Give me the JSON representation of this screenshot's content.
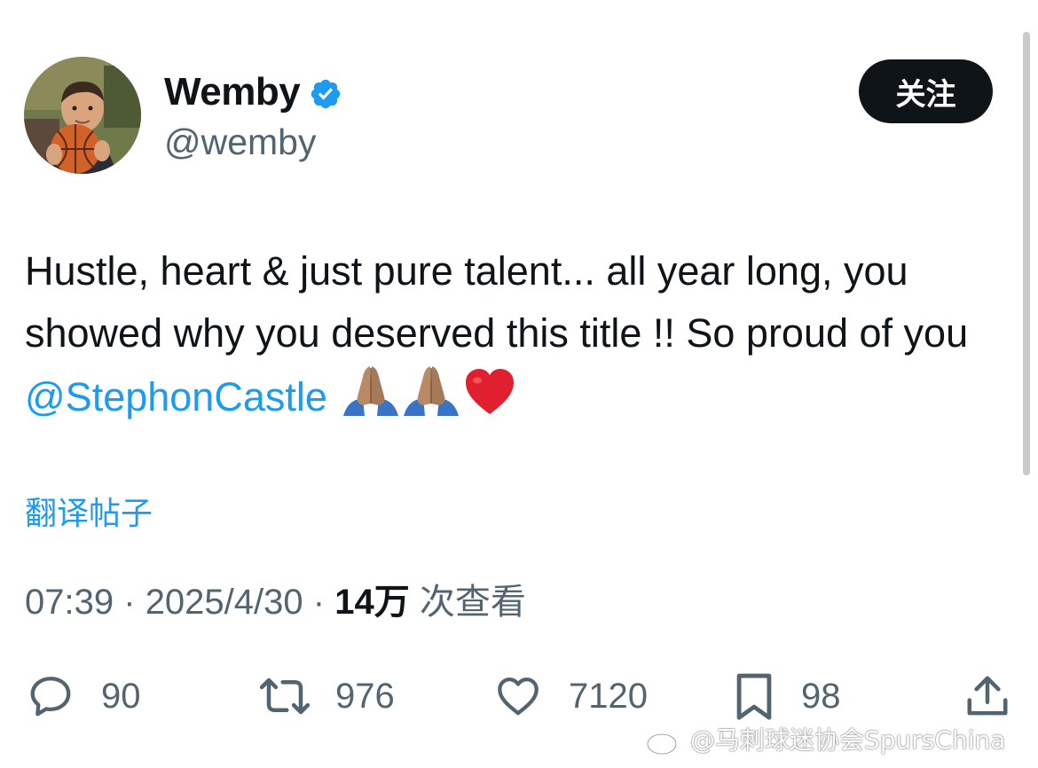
{
  "author": {
    "display_name": "Wemby",
    "handle": "@wemby",
    "verified": true
  },
  "follow_button": {
    "label": "关注"
  },
  "tweet": {
    "text_part1": "Hustle, heart & just pure talent... all year long, you showed why you deserved this title !! So proud of you ",
    "mention": "@StephonCastle",
    "emojis": [
      "praying-hands",
      "praying-hands",
      "red-heart"
    ]
  },
  "translate_link": {
    "label": "翻译帖子"
  },
  "meta": {
    "time": "07:39",
    "separator": "·",
    "date": "2025/4/30",
    "views_count": "14万",
    "views_label": "次查看"
  },
  "actions": {
    "replies": "90",
    "retweets": "976",
    "likes": "7120",
    "bookmarks": "98"
  },
  "watermark": {
    "text": "@马刺球迷协会SpursChina"
  },
  "colors": {
    "link_blue": "#1d9bf0",
    "text_primary": "#0f1419",
    "text_secondary": "#536471",
    "button_bg": "#0f1419",
    "heart_red": "#e0202e"
  }
}
